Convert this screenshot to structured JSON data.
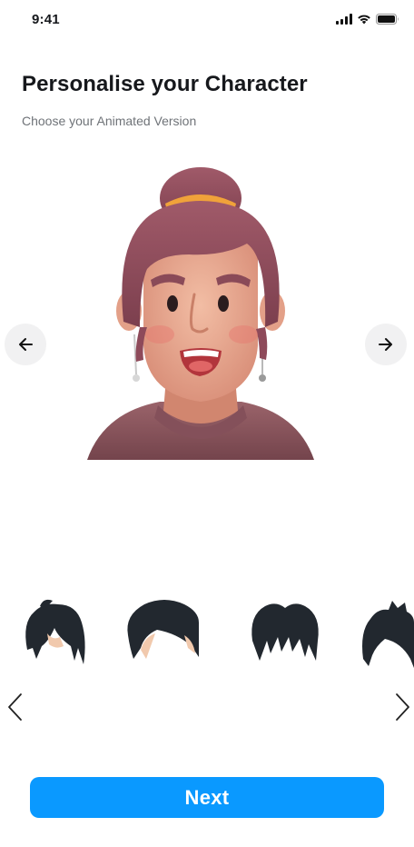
{
  "status_bar": {
    "time": "9:41",
    "icons": [
      "signal-icon",
      "wifi-icon",
      "battery-icon"
    ]
  },
  "header": {
    "title": "Personalise your Character",
    "subtitle": "Choose your Animated Version"
  },
  "avatar": {
    "icon": "character-avatar",
    "colors": {
      "hair": "#8e4a5a",
      "skin": "#e8a98f",
      "shirt": "#8a555c",
      "bun_band": "#f0a23a"
    }
  },
  "avatar_nav": {
    "prev_icon": "arrow-left-icon",
    "next_icon": "arrow-right-icon"
  },
  "hair_styles": {
    "options": [
      "hair-style-1",
      "hair-style-2",
      "hair-style-3",
      "hair-style-4"
    ],
    "prev_icon": "chevron-left-icon",
    "next_icon": "chevron-right-icon",
    "color": "#22282f"
  },
  "footer": {
    "next_label": "Next",
    "accent": "#0a99ff"
  }
}
